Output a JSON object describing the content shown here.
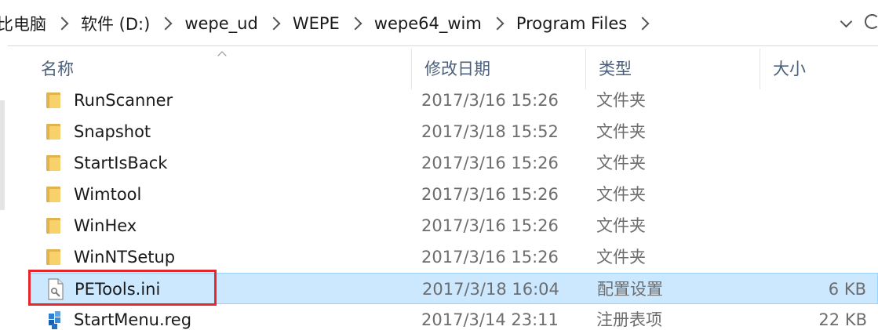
{
  "breadcrumb": {
    "items": [
      "比电脑",
      "软件 (D:)",
      "wepe_ud",
      "WEPE",
      "wepe64_wim",
      "Program Files"
    ]
  },
  "columns": {
    "name": "名称",
    "date": "修改日期",
    "type": "类型",
    "size": "大小"
  },
  "files": [
    {
      "name": "RunScanner",
      "date": "2017/3/16 15:26",
      "type": "文件夹",
      "size": "",
      "icon": "folder-icon"
    },
    {
      "name": "Snapshot",
      "date": "2017/3/18 15:52",
      "type": "文件夹",
      "size": "",
      "icon": "folder-icon"
    },
    {
      "name": "StartIsBack",
      "date": "2017/3/16 15:26",
      "type": "文件夹",
      "size": "",
      "icon": "folder-icon"
    },
    {
      "name": "Wimtool",
      "date": "2017/3/16 15:26",
      "type": "文件夹",
      "size": "",
      "icon": "folder-icon"
    },
    {
      "name": "WinHex",
      "date": "2017/3/16 15:26",
      "type": "文件夹",
      "size": "",
      "icon": "folder-icon"
    },
    {
      "name": "WinNTSetup",
      "date": "2017/3/16 15:26",
      "type": "文件夹",
      "size": "",
      "icon": "folder-icon"
    },
    {
      "name": "PETools.ini",
      "date": "2017/3/18 16:04",
      "type": "配置设置",
      "size": "6 KB",
      "icon": "ini-file-icon",
      "selected": true
    },
    {
      "name": "StartMenu.reg",
      "date": "2017/3/14 23:11",
      "type": "注册表项",
      "size": "22 KB",
      "icon": "reg-file-icon"
    }
  ],
  "colors": {
    "selection_bg": "#cce8ff",
    "selection_border": "#99d1ff",
    "highlight_annotation": "#e5262a",
    "folder": "#f7d16b"
  }
}
